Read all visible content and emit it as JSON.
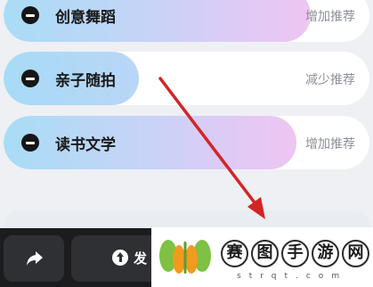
{
  "list": {
    "items": [
      {
        "title": "创意舞蹈",
        "action": "增加推荐"
      },
      {
        "title": "亲子随拍",
        "action": "减少推荐"
      },
      {
        "title": "读书文学",
        "action": "增加推荐"
      }
    ]
  },
  "icons": {
    "remove": "minus-circle-icon",
    "share": "share-arrow-icon",
    "post": "upload-circle-icon",
    "annotation": "red-arrow-icon",
    "watermark_logo": "butterfly-logo-icon"
  },
  "bottom_bar": {
    "post_label": "发"
  },
  "watermark": {
    "chars": [
      "赛",
      "图",
      "手",
      "游",
      "网"
    ],
    "sub": "strqt.com"
  },
  "colors": {
    "annotation_arrow": "#d42424",
    "logo_green": "#7dc242",
    "logo_orange": "#f39a1e",
    "pill_blue": "#a9dcf6",
    "pill_pink": "#eec5f2",
    "bottom_bar": "#1c1c1e"
  }
}
